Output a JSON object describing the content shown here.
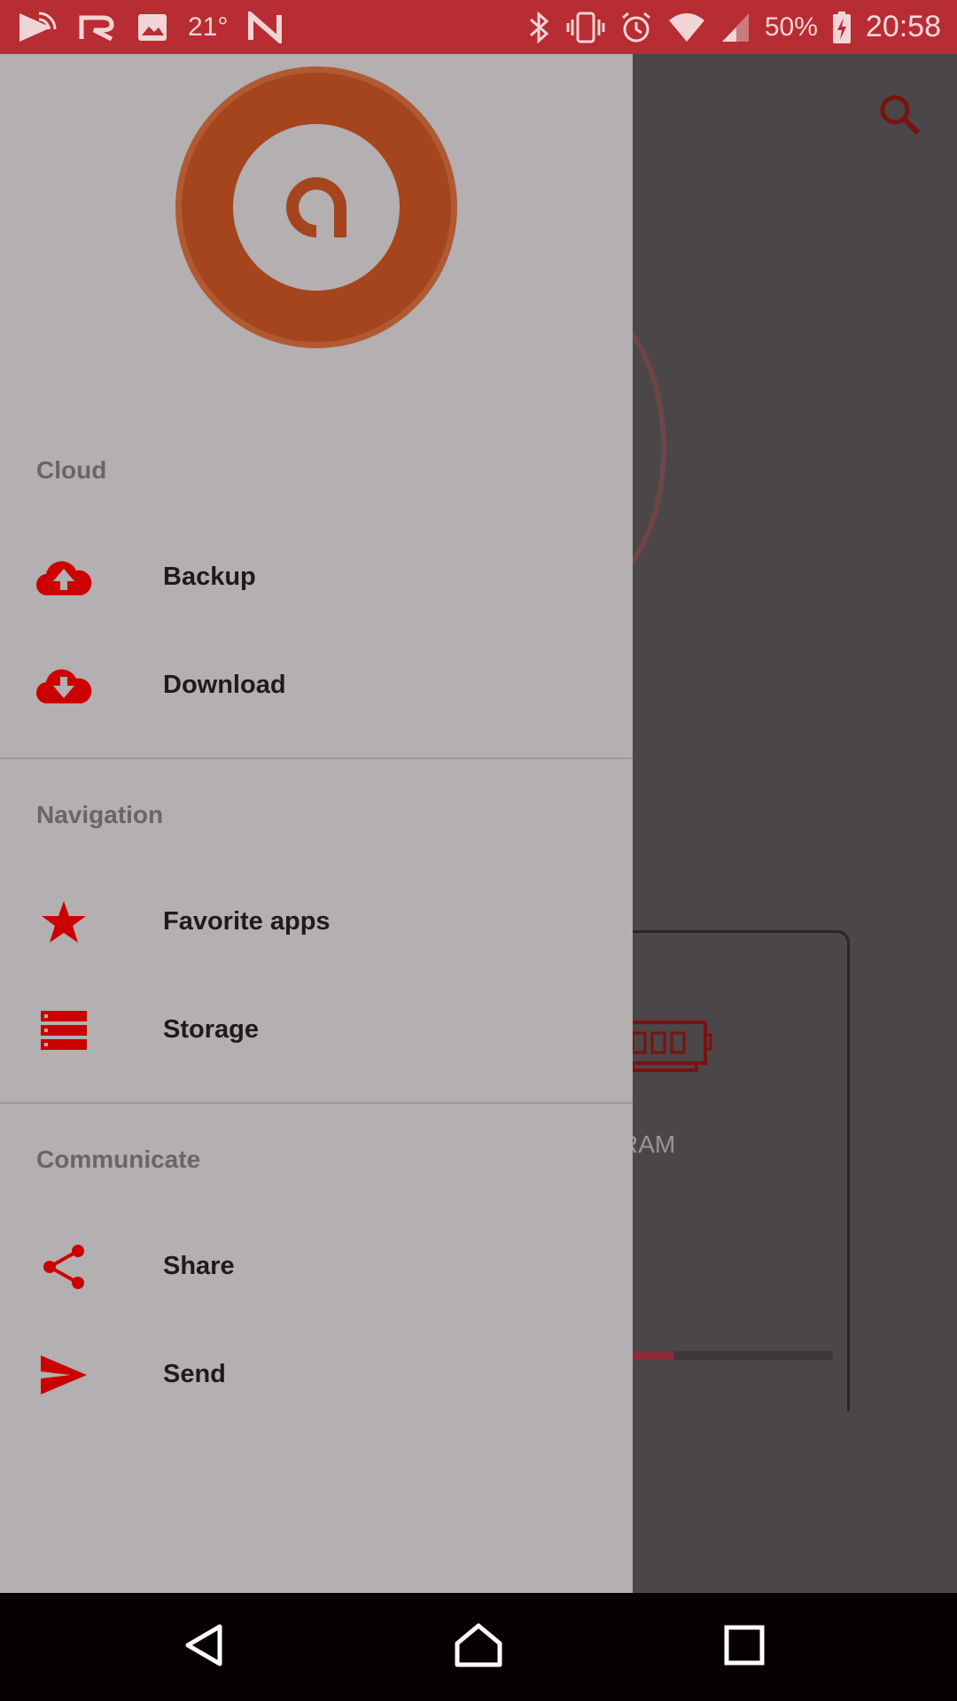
{
  "status_bar": {
    "temperature": "21°",
    "battery": "50%",
    "time": "20:58"
  },
  "background": {
    "ram_label": "RAM",
    "ram_usage_fraction": 0.25
  },
  "drawer": {
    "sections": [
      {
        "header": "Cloud",
        "items": [
          {
            "label": "Backup",
            "icon": "cloud-upload-icon"
          },
          {
            "label": "Download",
            "icon": "cloud-download-icon"
          }
        ]
      },
      {
        "header": "Navigation",
        "items": [
          {
            "label": "Favorite apps",
            "icon": "star-icon"
          },
          {
            "label": "Storage",
            "icon": "storage-icon"
          }
        ]
      },
      {
        "header": "Communicate",
        "items": [
          {
            "label": "Share",
            "icon": "share-icon"
          },
          {
            "label": "Send",
            "icon": "send-icon"
          }
        ]
      }
    ]
  },
  "colors": {
    "accent": "#cc0000",
    "status_bar": "#b82c33",
    "drawer_bg": "#b4afb0",
    "logo": "#a5451d"
  }
}
